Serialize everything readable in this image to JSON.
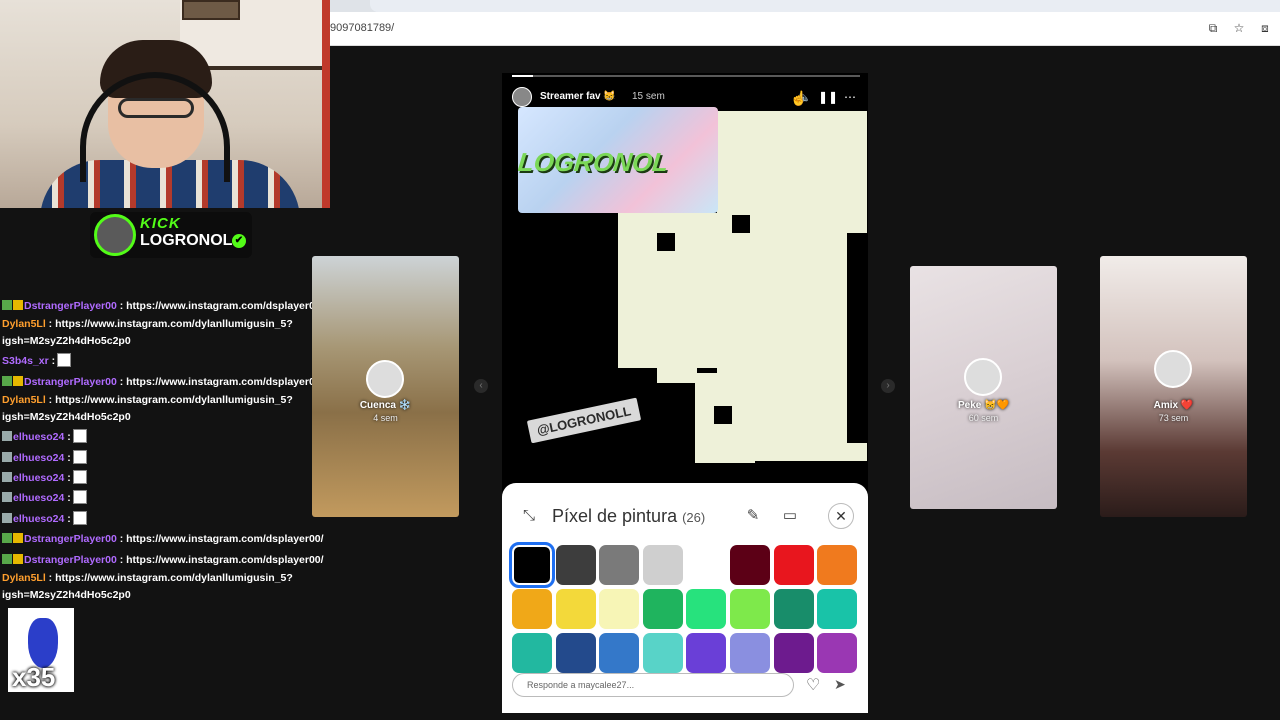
{
  "browser": {
    "url": "9097081789/"
  },
  "overlay": {
    "kick_word": "KICK",
    "channel_name": "LOGRONOL",
    "verified": "✔"
  },
  "chat": {
    "messages": [
      {
        "user": "DstrangerPlayer00",
        "user_color": "purple",
        "text": ": https://www.instagram.com/dsplayer00/",
        "badges": [
          "g",
          "y"
        ]
      },
      {
        "user": "Dylan5Ll",
        "user_color": "orange",
        "text": ": https://www.instagram.com/dylanllumigusin_5?igsh=M2syZ2h4dHo5c2p0",
        "badges": []
      },
      {
        "user": "S3b4s_xr",
        "user_color": "purple",
        "text": ":",
        "badges": [],
        "emote": true
      },
      {
        "user": "DstrangerPlayer00",
        "user_color": "purple",
        "text": ": https://www.instagram.com/dsplayer00/",
        "badges": [
          "g",
          "y"
        ]
      },
      {
        "user": "Dylan5Ll",
        "user_color": "orange",
        "text": ": https://www.instagram.com/dylanllumigusin_5?igsh=M2syZ2h4dHo5c2p0",
        "badges": []
      },
      {
        "user": "elhueso24",
        "user_color": "purple",
        "text": ":",
        "badges": [
          "s"
        ],
        "emote": true
      },
      {
        "user": "elhueso24",
        "user_color": "purple",
        "text": ":",
        "badges": [
          "s"
        ],
        "emote": true
      },
      {
        "user": "elhueso24",
        "user_color": "purple",
        "text": ":",
        "badges": [
          "s"
        ],
        "emote": true
      },
      {
        "user": "elhueso24",
        "user_color": "purple",
        "text": ":",
        "badges": [
          "s"
        ],
        "emote": true
      },
      {
        "user": "elhueso24",
        "user_color": "purple",
        "text": ":",
        "badges": [
          "s"
        ],
        "emote": true
      },
      {
        "user": "DstrangerPlayer00",
        "user_color": "purple",
        "text": ": https://www.instagram.com/dsplayer00/",
        "badges": [
          "g",
          "y"
        ]
      },
      {
        "user": "DstrangerPlayer00",
        "user_color": "purple",
        "text": ": https://www.instagram.com/dsplayer00/",
        "badges": [
          "g",
          "y"
        ]
      },
      {
        "user": "Dylan5Ll",
        "user_color": "orange",
        "text": ": https://www.instagram.com/dylanllumigusin_5?igsh=M2syZ2h4dHo5c2p0",
        "badges": []
      }
    ],
    "big_emote_count": "x35"
  },
  "stories": {
    "left": {
      "name": "Cuenca ❄️",
      "time": "4 sem"
    },
    "right1": {
      "name": "Peke 😸🧡",
      "time": "60 sem"
    },
    "right2": {
      "name": "Amix ❤️",
      "time": "73 sem"
    }
  },
  "main_story": {
    "progress": 0.06,
    "username": "Streamer fav 😸",
    "time": "15 sem",
    "thumb_text": "LOGRONOL",
    "sticker": "@LOGRONOLL",
    "reply_placeholder": "Responde a maycalee27..."
  },
  "paint_panel": {
    "title": "Píxel de pintura",
    "count": "(26)",
    "colors": [
      "#000000",
      "#3d3d3d",
      "#7a7a7a",
      "#cfcfcf",
      "#ffffff",
      "#5c0016",
      "#e8161e",
      "#f07a1e",
      "#f0a818",
      "#f3d93a",
      "#f7f5b6",
      "#1fb45e",
      "#27e27d",
      "#7ee94b",
      "#188d6a",
      "#19c3a8",
      "#22b8a0",
      "#234a8c",
      "#3478c9",
      "#58d3c8",
      "#6a3fd7",
      "#8a8fe0",
      "#6d1b8e",
      "#9a37b3"
    ],
    "selected_index": 0
  }
}
